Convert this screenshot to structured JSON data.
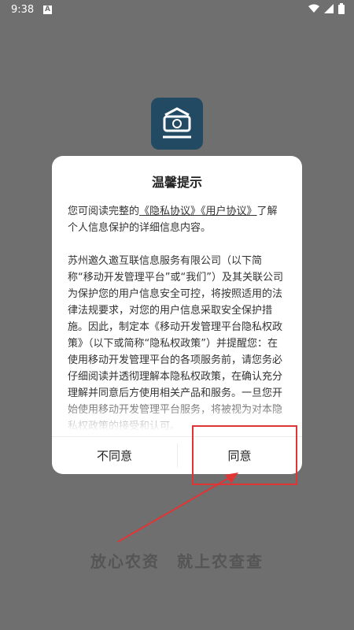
{
  "status_bar": {
    "time": "9:38",
    "badge": "A"
  },
  "dialog": {
    "title": "温馨提示",
    "intro_before": "您可阅读完整的",
    "privacy_link": "《隐私协议》",
    "user_link": "《用户协议》",
    "intro_after": "了解个人信息保护的详细信息内容。",
    "policy_text": "苏州邀久邀互联信息服务有限公司（以下简称“移动开发管理平台”或“我们”）及其关联公司为保护您的用户信息安全可控，将按照适用的法律法规要求，对您的用户信息采取安全保护措施。因此，制定本《移动开发管理平台隐私权政策》（以下或简称“隐私权政策”）并提醒您：在使用移动开发管理平台的各项服务前，请您务必仔细阅读并透彻理解本隐私权政策，在确认充分理解并同意后方使用相关产品和服务。一旦您开始使用移动开发管理平台服务，将被视为对本隐私权政策的接受和认可。",
    "disagree_label": "不同意",
    "agree_label": "同意"
  },
  "slogan": "放心农资　就上农查查",
  "colors": {
    "background": "#6f6f6f",
    "highlight": "#e03535",
    "logo": "#234a63"
  }
}
